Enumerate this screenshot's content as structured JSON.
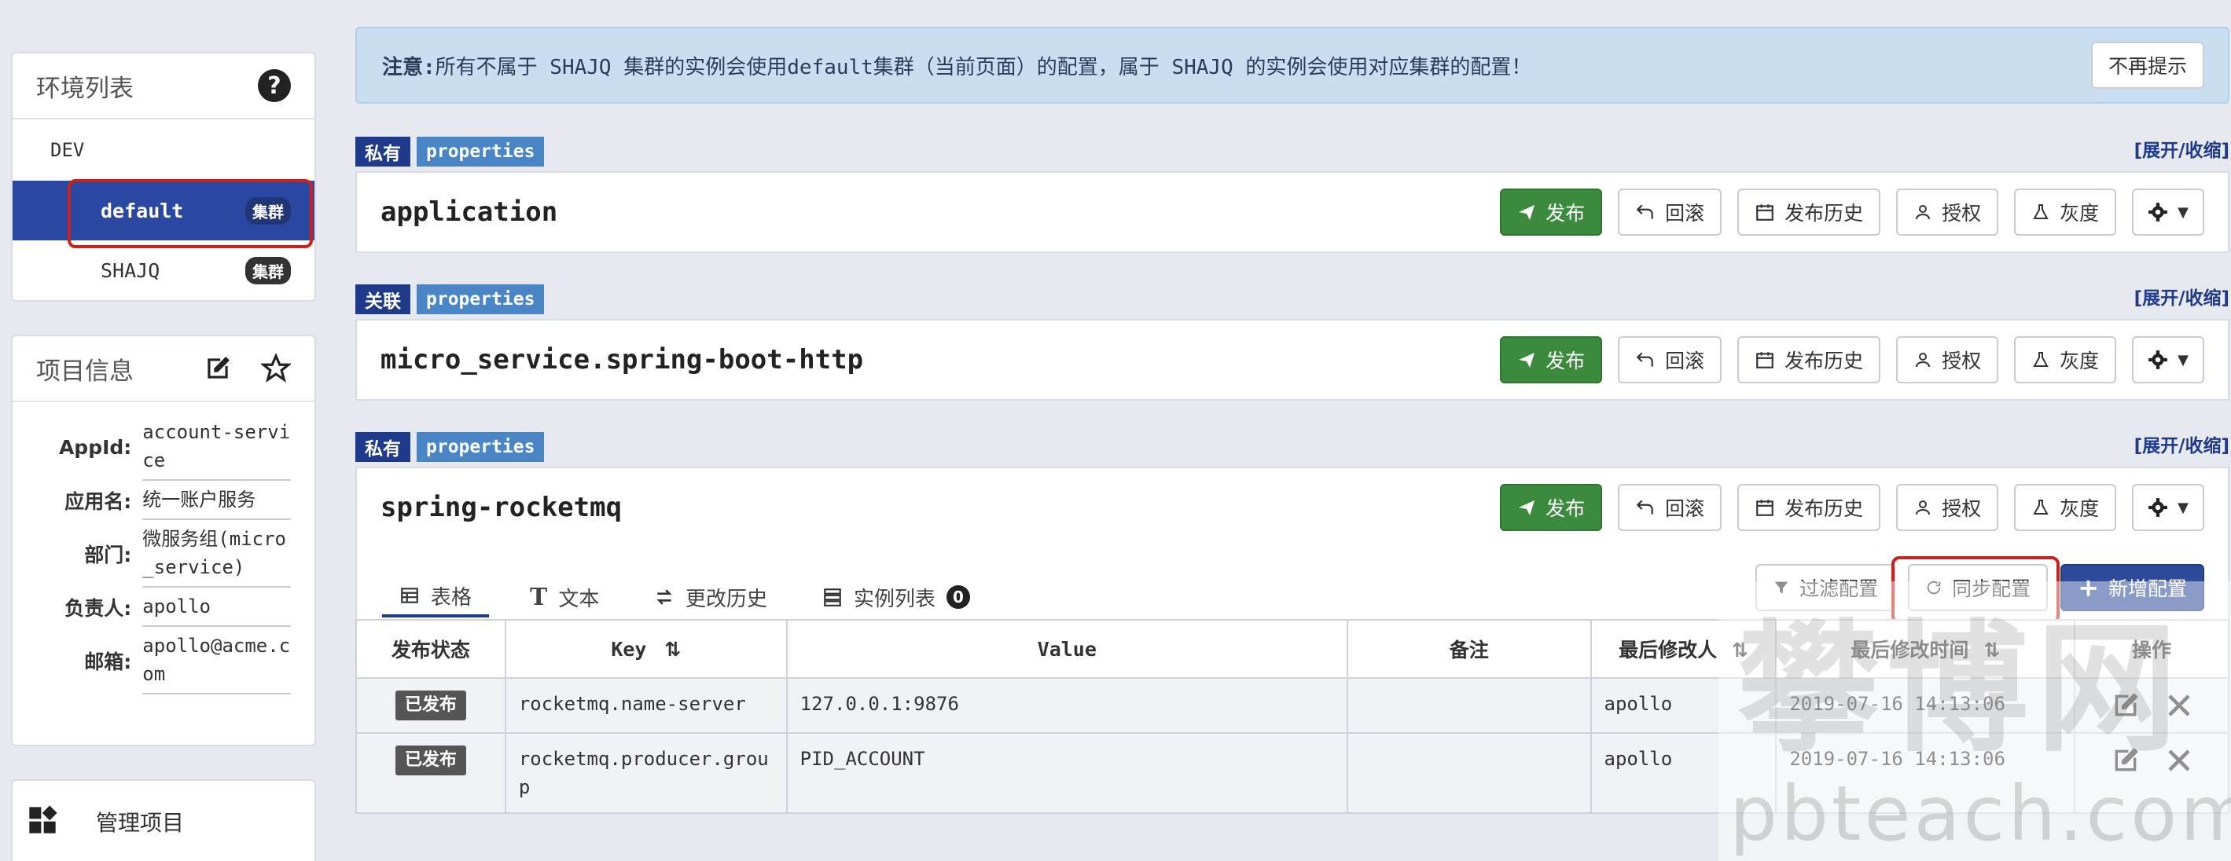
{
  "sidebar": {
    "env_title": "环境列表",
    "env_name": "DEV",
    "clusters": [
      {
        "name": "default",
        "badge": "集群",
        "active": true
      },
      {
        "name": "SHAJQ",
        "badge": "集群",
        "active": false
      }
    ],
    "project_title": "项目信息",
    "info": [
      {
        "label": "AppId:",
        "value": "account-service"
      },
      {
        "label": "应用名:",
        "value": "统一账户服务"
      },
      {
        "label": "部门:",
        "value": "微服务组(micro_service)"
      },
      {
        "label": "负责人:",
        "value": "apollo"
      },
      {
        "label": "邮箱:",
        "value": "apollo@acme.com"
      }
    ],
    "manage_label": "管理项目"
  },
  "notice": {
    "prefix": "注意:",
    "text": "所有不属于 SHAJQ 集群的实例会使用default集群（当前页面）的配置，属于 SHAJQ 的实例会使用对应集群的配置！",
    "dismiss_label": "不再提示"
  },
  "namespaces": [
    {
      "scope": "私有",
      "format": "properties",
      "name": "application"
    },
    {
      "scope": "关联",
      "format": "properties",
      "name": "micro_service.spring-boot-http"
    },
    {
      "scope": "私有",
      "format": "properties",
      "name": "spring-rocketmq"
    }
  ],
  "expand_label": "[展开/收缩]",
  "actions": {
    "publish": "发布",
    "rollback": "回滚",
    "history": "发布历史",
    "grant": "授权",
    "gray": "灰度"
  },
  "tabs": [
    {
      "label": "表格",
      "active": true
    },
    {
      "label": "文本",
      "active": false
    },
    {
      "label": "更改历史",
      "active": false
    },
    {
      "label": "实例列表",
      "active": false,
      "count": "0"
    }
  ],
  "toolbar": {
    "filter": "过滤配置",
    "sync": "同步配置",
    "add": "新增配置"
  },
  "table": {
    "headers": [
      "发布状态",
      "Key",
      "Value",
      "备注",
      "最后修改人",
      "最后修改时间",
      "操作"
    ],
    "rows": [
      {
        "status": "已发布",
        "key": "rocketmq.name-server",
        "value": "127.0.0.1:9876",
        "comment": "",
        "modifier": "apollo",
        "time": "2019-07-16 14:13:06"
      },
      {
        "status": "已发布",
        "key": "rocketmq.producer.group",
        "value": "PID_ACCOUNT",
        "comment": "",
        "modifier": "apollo",
        "time": "2019-07-16 14:13:06"
      }
    ]
  },
  "watermark": {
    "cn": "攀博网",
    "en": "pbteach.com"
  },
  "colors": {
    "primary": "#2a47a1",
    "publish": "#3b8a3e",
    "highlight": "#c6231e",
    "notice_bg": "#c9def0"
  }
}
